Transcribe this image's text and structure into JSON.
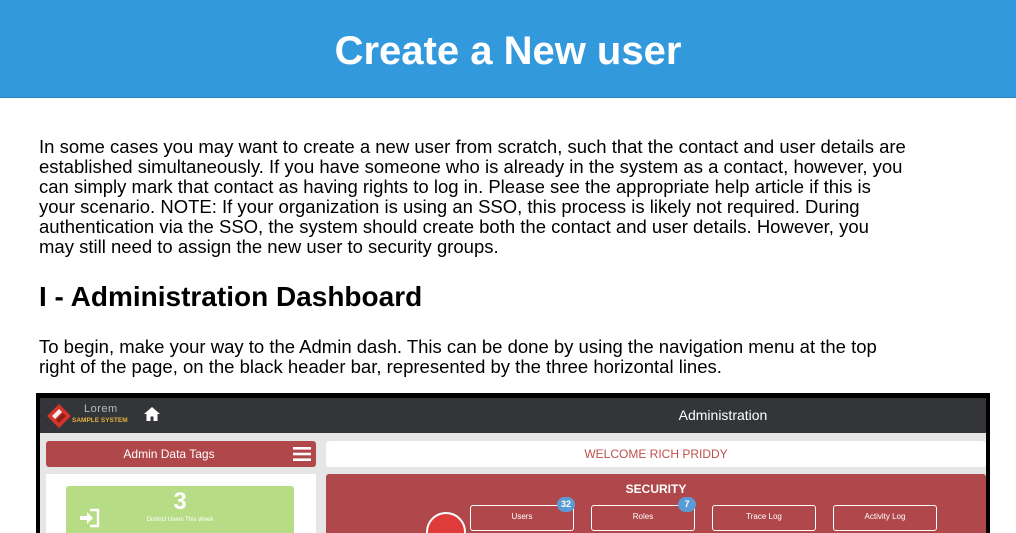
{
  "header": {
    "title": "Create a New user"
  },
  "intro": {
    "lines": [
      "In some cases you may want to create a new user from scratch, such that the contact and user details are",
      "established simultaneously.  If you have someone who is already in the system as a contact, however, you",
      "can simply mark that contact as having rights to log in.  Please see the appropriate help article if this is",
      "your scenario.  NOTE: If your organization is using an SSO, this process is likely not required.  During",
      "authentication via the SSO, the system should create both the contact and user details.  However, you",
      "may still need to assign the new user to security groups."
    ]
  },
  "section1": {
    "heading": "I - Administration Dashboard",
    "lines": [
      "To begin, make your way to the Admin dash.  This can be done by using the navigation menu at the top",
      "right of the page, on the black header bar, represented by the three horizontal lines."
    ]
  },
  "screenshot": {
    "logo_name": "Lorem",
    "logo_sub": "SAMPLE SYSTEM",
    "page_title": "Administration",
    "tags_label": "Admin Data Tags",
    "welcome": "WELCOME RICH PRIDDY",
    "stat": {
      "value": "3",
      "label": "Distinct Users This Week"
    },
    "security": {
      "title": "SECURITY",
      "buttons": [
        {
          "label": "Users",
          "badge": "32"
        },
        {
          "label": "Roles",
          "badge": "7"
        },
        {
          "label": "Trace Log",
          "badge": ""
        },
        {
          "label": "Activity Log",
          "badge": ""
        }
      ]
    },
    "colors": {
      "header_blue": "#3399dd",
      "accent_red": "#b0474a",
      "stat_green": "#b7dc86",
      "badge_blue": "#5b9bd5"
    },
    "icons": [
      "home-icon",
      "menu-icon",
      "sign-in-icon"
    ]
  }
}
